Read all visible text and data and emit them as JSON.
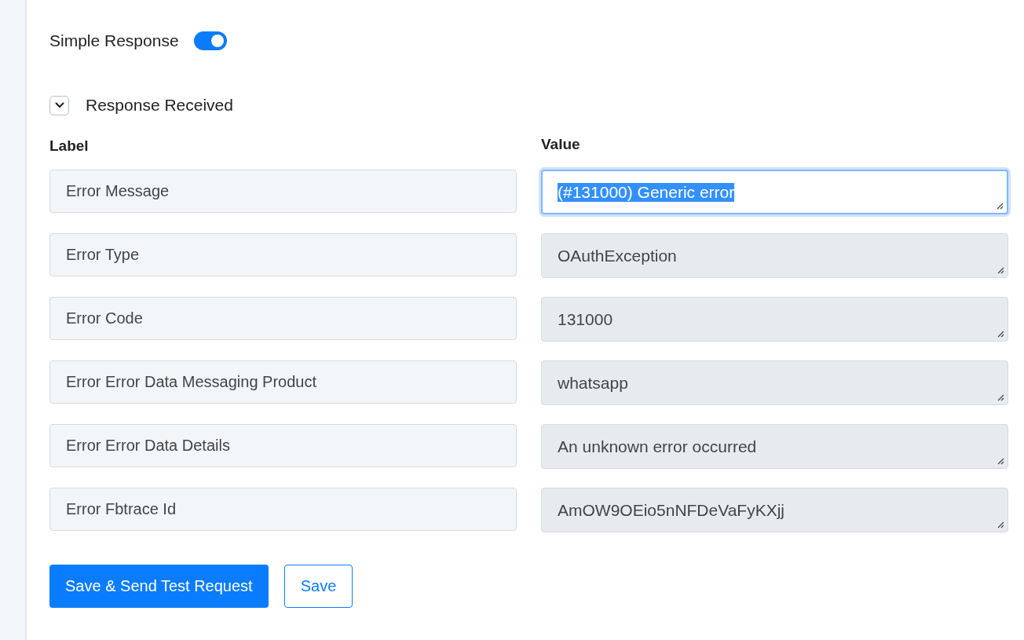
{
  "simple_response": {
    "label": "Simple Response",
    "on": true
  },
  "response_section": {
    "title": "Response Received",
    "expanded": true
  },
  "columns": {
    "label": "Label",
    "value": "Value"
  },
  "rows": [
    {
      "label": "Error Message",
      "value": "(#131000) Generic error",
      "focused": true
    },
    {
      "label": "Error Type",
      "value": "OAuthException",
      "focused": false
    },
    {
      "label": "Error Code",
      "value": "131000",
      "focused": false
    },
    {
      "label": "Error Error Data Messaging Product",
      "value": "whatsapp",
      "focused": false
    },
    {
      "label": "Error Error Data Details",
      "value": "An unknown error occurred",
      "focused": false
    },
    {
      "label": "Error Fbtrace Id",
      "value": "AmOW9OEio5nNFDeVaFyKXjj",
      "focused": false
    }
  ],
  "buttons": {
    "primary": "Save & Send Test Request",
    "secondary": "Save"
  }
}
